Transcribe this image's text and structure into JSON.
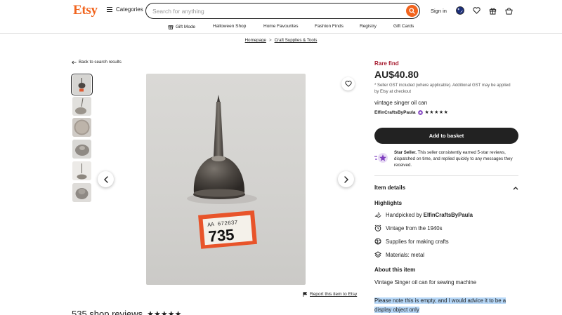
{
  "header": {
    "logo": "Etsy",
    "categories_label": "Categories",
    "search_placeholder": "Search for anything",
    "signin_label": "Sign in",
    "icons": [
      "hamburger-icon",
      "search-icon",
      "globe-flag-icon",
      "heart-icon",
      "gift-icon",
      "basket-icon"
    ]
  },
  "nav": {
    "items": [
      {
        "label": "Gift Mode",
        "icon": "gift-icon"
      },
      {
        "label": "Halloween Shop"
      },
      {
        "label": "Home Favourites"
      },
      {
        "label": "Fashion Finds"
      },
      {
        "label": "Registry"
      },
      {
        "label": "Gift Cards"
      }
    ]
  },
  "breadcrumb": {
    "home": "Homepage",
    "separator": ">",
    "category": "Craft Supplies & Tools"
  },
  "back_label": "Back to search results",
  "gallery": {
    "thumbnail_count": 6,
    "selected_index": 0,
    "tag_line1": "AA 672637",
    "tag_line2": "735",
    "report_label": "Report this item to Etsy"
  },
  "reviews_peek": {
    "text": "535 shop reviews",
    "stars": "★★★★★"
  },
  "listing": {
    "badge": "Rare find",
    "price": "AU$40.80",
    "gst_note": "* Seller GST included (where applicable). Additional GST may be applied by Etsy at checkout",
    "title": "vintage singer oil can",
    "shop_name": "ElfinCraftsByPaula",
    "shop_stars": "★★★★★",
    "add_to_basket": "Add to basket",
    "star_seller_title": "Star Seller.",
    "star_seller_text": "This seller consistently earned 5-star reviews, dispatched on time, and replied quickly to any messages they received."
  },
  "details": {
    "section_title": "Item details",
    "highlights_title": "Highlights",
    "highlights": [
      {
        "prefix": "Handpicked by ",
        "bold": "ElfinCraftsByPaula",
        "icon": "hand-icon"
      },
      {
        "prefix": "Vintage from the 1940s",
        "bold": "",
        "icon": "clock-icon"
      },
      {
        "prefix": "Supplies for making crafts",
        "bold": "",
        "icon": "yarn-icon"
      },
      {
        "prefix": "Materials: metal",
        "bold": "",
        "icon": "layers-icon"
      }
    ],
    "about_title": "About this item",
    "description_line1": "Vintage Singer oil can for sewing machine",
    "description_line2": "Please note this is empty, and I would advice it to be a display object only"
  },
  "colors": {
    "brand": "#f1641e",
    "rare_find": "#a61a2e",
    "star_seller": "#7f3fbf",
    "selection": "#b6d7f7"
  }
}
